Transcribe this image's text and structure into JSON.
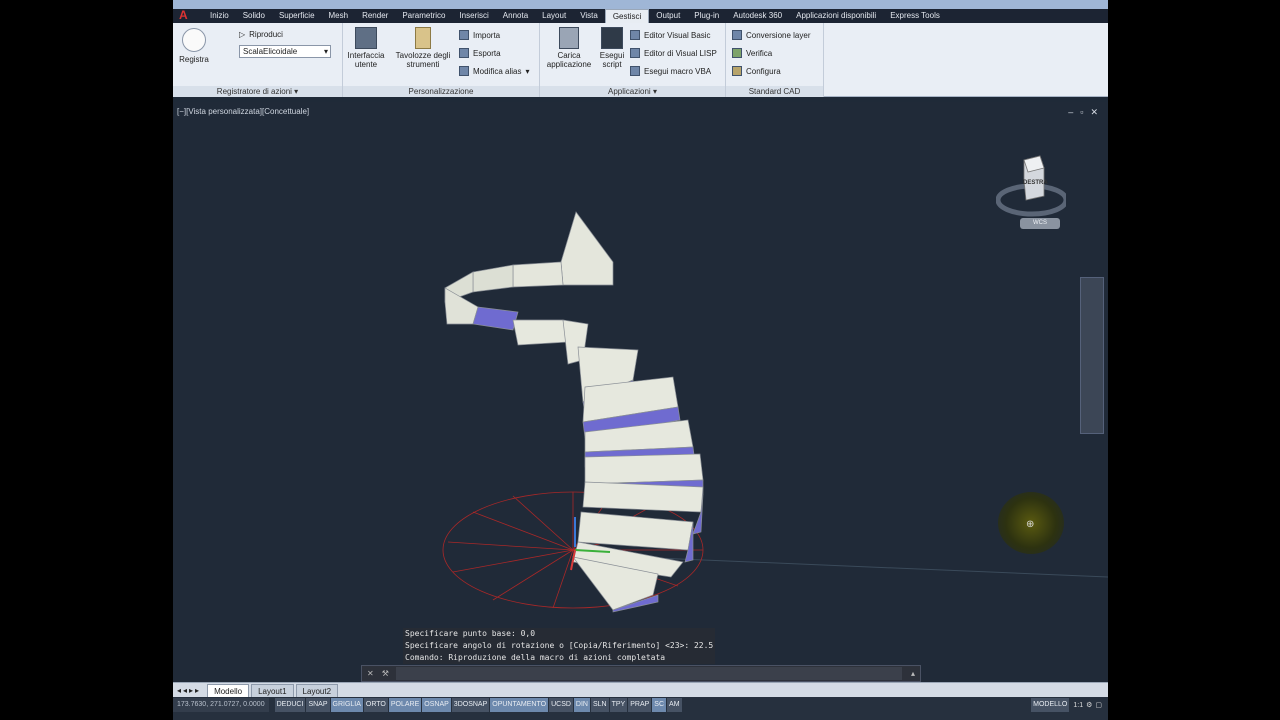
{
  "ribbon_tabs": [
    "Inizio",
    "Solido",
    "Superficie",
    "Mesh",
    "Render",
    "Parametrico",
    "Inserisci",
    "Annota",
    "Layout",
    "Vista",
    "Gestisci",
    "Output",
    "Plug-in",
    "Autodesk 360",
    "Applicazioni disponibili",
    "Express Tools"
  ],
  "active_tab": "Gestisci",
  "action_recorder": {
    "record_label": "Registra",
    "play_label": "Riproduci",
    "macro_name": "ScalaElicoidale",
    "panel_title": "Registratore di azioni"
  },
  "customization": {
    "ui_label_1": "Interfaccia",
    "ui_label_2": "utente",
    "palettes_label_1": "Tavolozze degli",
    "palettes_label_2": "strumenti",
    "import_label": "Importa",
    "export_label": "Esporta",
    "edit_alias_label": "Modifica alias",
    "panel_title": "Personalizzazione"
  },
  "applications": {
    "load_label_1": "Carica",
    "load_label_2": "applicazione",
    "run_label_1": "Esegui",
    "run_label_2": "script",
    "vb_editor_label": "Editor Visual Basic",
    "lisp_editor_label": "Editor di Visual LISP",
    "vba_macro_label": "Esegui macro VBA",
    "panel_title": "Applicazioni"
  },
  "cad_standards": {
    "layer_convert_label": "Conversione layer",
    "check_label": "Verifica",
    "configure_label": "Configura",
    "panel_title": "Standard CAD"
  },
  "viewport": {
    "label": "[−][Vista personalizzata][Concettuale]",
    "viewcube_face": "DESTRA",
    "wcs_label": "WCS"
  },
  "command_history": [
    "Specificare punto base: 0,0",
    "Specificare angolo di rotazione o [Copia/Riferimento] <23>: 22.5",
    "Comando: Riproduzione della macro di azioni completata"
  ],
  "layout_tabs": [
    "Modello",
    "Layout1",
    "Layout2"
  ],
  "active_layout": "Modello",
  "status": {
    "coords": "173.7630, 271.0727, 0.0000",
    "toggles": [
      {
        "label": "DEDUCI",
        "on": false
      },
      {
        "label": "SNAP",
        "on": false
      },
      {
        "label": "GRIGLIA",
        "on": true
      },
      {
        "label": "ORTO",
        "on": false
      },
      {
        "label": "POLARE",
        "on": true
      },
      {
        "label": "OSNAP",
        "on": true
      },
      {
        "label": "3DOSNAP",
        "on": false
      },
      {
        "label": "OPUNTAMENTO",
        "on": true
      },
      {
        "label": "UCSD",
        "on": false
      },
      {
        "label": "DIN",
        "on": true
      },
      {
        "label": "SLN",
        "on": false
      },
      {
        "label": "TPY",
        "on": false
      },
      {
        "label": "PRAP",
        "on": false
      },
      {
        "label": "SC",
        "on": true
      },
      {
        "label": "AM",
        "on": false
      }
    ],
    "space": "MODELLO",
    "scale": "1:1"
  }
}
